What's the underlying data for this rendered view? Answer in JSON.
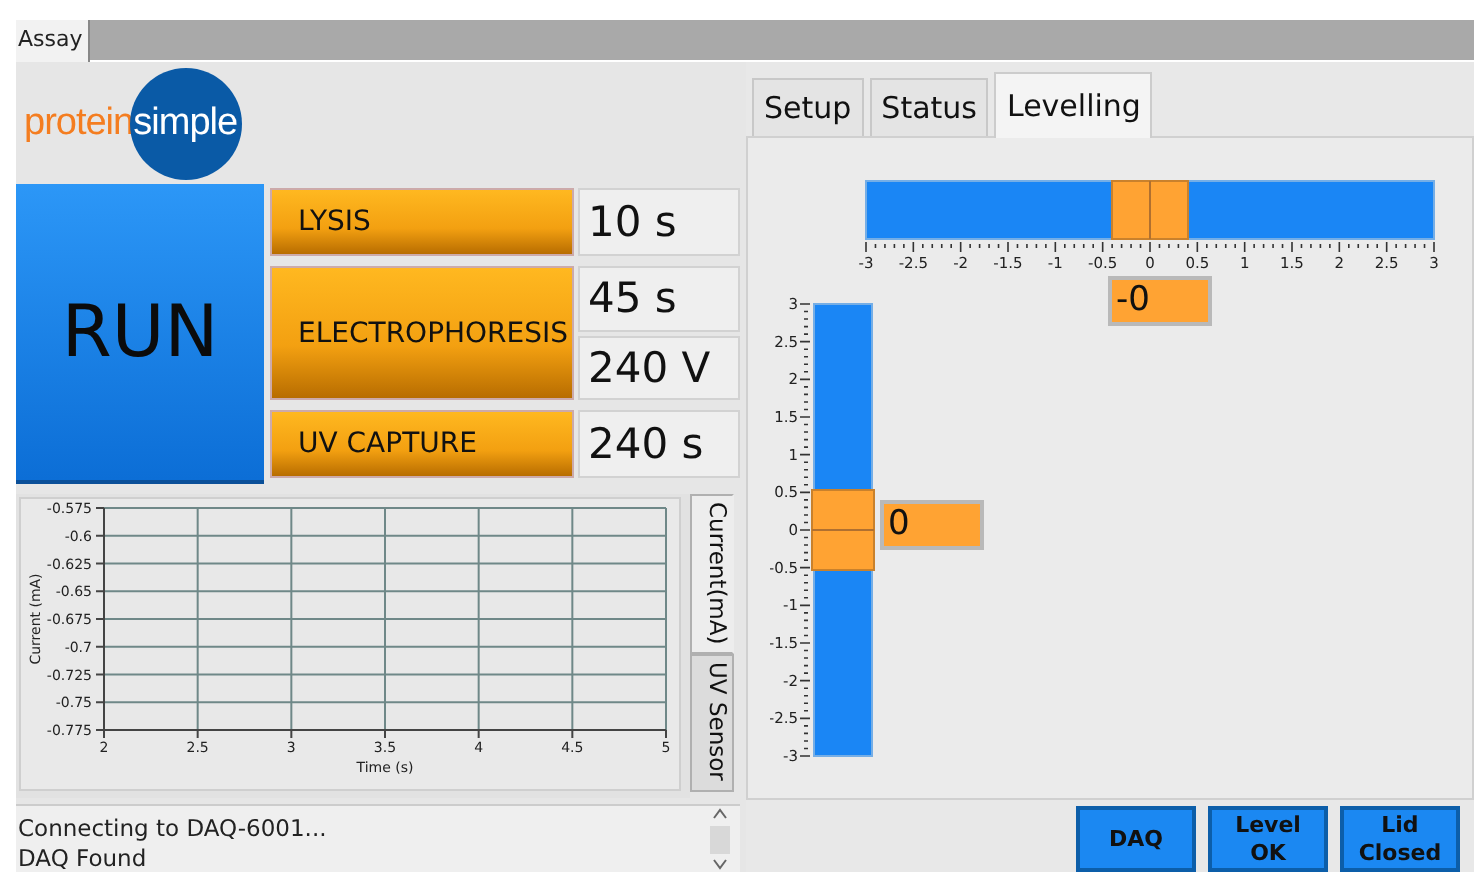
{
  "window_tab": {
    "label": "Assay",
    "selected": true
  },
  "logo": {
    "word_1": "protein",
    "word_2": "simple"
  },
  "run_button": {
    "label": "RUN"
  },
  "stages": [
    {
      "label": "LYSIS",
      "values": [
        "10 s"
      ]
    },
    {
      "label": "ELECTROPHORESIS",
      "values": [
        "45 s",
        "240 V"
      ]
    },
    {
      "label": "UV CAPTURE",
      "values": [
        "240 s"
      ]
    }
  ],
  "chart": {
    "chart_data": {
      "type": "line",
      "grid": true,
      "xlabel": "Time (s)",
      "ylabel": "Current (mA)",
      "xlim": [
        2,
        5
      ],
      "ylim": [
        -0.775,
        -0.575
      ],
      "xticks": [
        2,
        2.5,
        3,
        3.5,
        4,
        4.5,
        5
      ],
      "yticks": [
        -0.575,
        -0.6,
        -0.625,
        -0.65,
        -0.675,
        -0.7,
        -0.725,
        -0.75,
        -0.775
      ]
    }
  },
  "graph_tabs": [
    {
      "label": "Current(mA)",
      "selected": true
    },
    {
      "label": "UV Sensor",
      "selected": false
    }
  ],
  "log": [
    "Connecting to DAQ-6001...",
    "DAQ Found"
  ],
  "tabs": [
    {
      "label": "Setup",
      "selected": false
    },
    {
      "label": "Status",
      "selected": false
    },
    {
      "label": "Levelling",
      "selected": true
    }
  ],
  "levelling": {
    "x_slider": {
      "level": 0.5,
      "reading": "-0",
      "scale": [
        "-3",
        "-2.5",
        "-2",
        "-1.5",
        "-1",
        "-0.5",
        "0",
        "0.5",
        "1",
        "1.5",
        "2",
        "2.5",
        "3"
      ]
    },
    "y_slider": {
      "level": 0.5,
      "reading": "0",
      "scale": [
        "3",
        "2.5",
        "2",
        "1.5",
        "1",
        "0.5",
        "0",
        "-0.5",
        "-1",
        "-1.5",
        "-2",
        "-2.5",
        "-3"
      ]
    }
  },
  "indicators": [
    {
      "label": "DAQ",
      "on": true
    },
    {
      "label": "Level\nOK",
      "on": true
    },
    {
      "label": "Lid\nClosed",
      "on": true
    }
  ]
}
